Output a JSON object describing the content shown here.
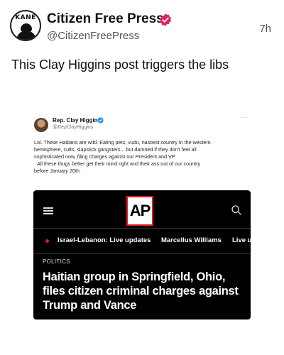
{
  "post": {
    "avatar_text": "KANE",
    "display_name": "Citizen Free Press",
    "handle": "@CitizenFreePress",
    "timestamp": "7h",
    "text": "This Clay Higgins post triggers the libs",
    "verified_color": "#e0245e"
  },
  "embed": {
    "name": "Rep. Clay Higgins",
    "handle": "@RepClayHiggins",
    "more": "···",
    "body_lines": [
      "Lol. These Haitians are wild. Eating pets, vudu, nastiest country in the western",
      "hemisphere, cults, slapstick gangsters... but damned if they don't feel all",
      "sophisticated now, filing charges against our President and VP.",
      "All these thugs better get their mind right and their ass out of our country",
      "before January 20th."
    ],
    "verified_color": "#1d9bf0"
  },
  "article": {
    "logo": "AP",
    "nav": {
      "item1": "Israel-Lebanon: Live updates",
      "item2": "Marcellus Williams",
      "item3": "Live u"
    },
    "section": "POLITICS",
    "headline_lines": [
      "Haitian group in Springfield, Ohio,",
      "files citizen criminal charges against",
      "Trump and Vance"
    ],
    "accent": "#e21b1b"
  }
}
